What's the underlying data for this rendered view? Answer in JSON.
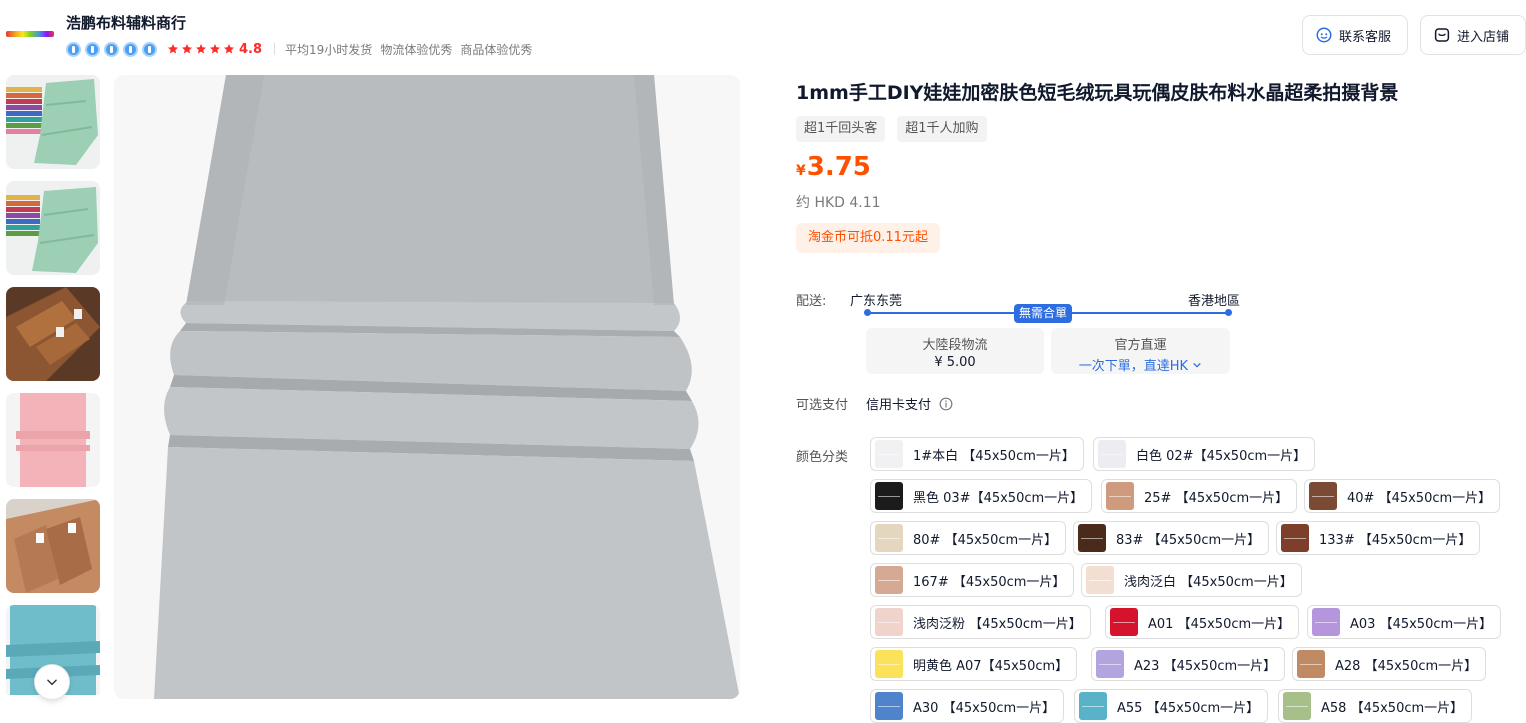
{
  "shop": {
    "name": "浩鹏布料辅料商行",
    "rating": "4.8",
    "meta": [
      "平均19小时发货",
      "物流体验优秀",
      "商品体验优秀"
    ],
    "service_label": "联系客服",
    "store_label": "进入店铺"
  },
  "product": {
    "title": "1mm手工DIY娃娃加密肤色短毛绒玩具玩偶皮肤布料水晶超柔拍摄背景",
    "tags": [
      "超1千回头客",
      "超1千人加购"
    ],
    "price_currency": "¥",
    "price": "3.75",
    "price_converted": "约 HKD 4.11",
    "coin_offer": "淘金币可抵0.11元起"
  },
  "shipping": {
    "label": "配送:",
    "from": "广东东莞",
    "to": "香港地區",
    "badge": "無需合單",
    "option_a_title": "大陸段物流",
    "option_a_price": "¥ 5.00",
    "option_b_title": "官方直運",
    "option_b_desc": "一次下單，直達HK"
  },
  "payment": {
    "label": "可选支付",
    "value": "信用卡支付"
  },
  "colors": {
    "label": "颜色分类",
    "items": [
      {
        "label": "1#本白 【45x50cm一片】",
        "swatch": "#f1f1f4"
      },
      {
        "label": "白色 02#【45x50cm一片】",
        "swatch": "#ececf2"
      },
      {
        "label": "黑色 03#【45x50cm一片】",
        "swatch": "#1b1b1b"
      },
      {
        "label": "25# 【45x50cm一片】",
        "swatch": "#cf9a7d"
      },
      {
        "label": "40# 【45x50cm一片】",
        "swatch": "#7a4a35"
      },
      {
        "label": "80# 【45x50cm一片】",
        "swatch": "#e5d6c0"
      },
      {
        "label": "83# 【45x50cm一片】",
        "swatch": "#4a2a1a"
      },
      {
        "label": "133# 【45x50cm一片】",
        "swatch": "#7d3f2c"
      },
      {
        "label": "167# 【45x50cm一片】",
        "swatch": "#d5a993"
      },
      {
        "label": "浅肉泛白 【45x50cm一片】",
        "swatch": "#f3dfd2"
      },
      {
        "label": "浅肉泛粉 【45x50cm一片】",
        "swatch": "#f0d3cb"
      },
      {
        "label": "A01 【45x50cm一片】",
        "swatch": "#d6132c"
      },
      {
        "label": "A03 【45x50cm一片】",
        "swatch": "#b596dc"
      },
      {
        "label": "明黄色 A07【45x50cm】",
        "swatch": "#fbe25a"
      },
      {
        "label": "A23 【45x50cm一片】",
        "swatch": "#b3a4e0"
      },
      {
        "label": "A28 【45x50cm一片】",
        "swatch": "#c08b63"
      },
      {
        "label": "A30 【45x50cm一片】",
        "swatch": "#4f83cc"
      },
      {
        "label": "A55 【45x50cm一片】",
        "swatch": "#58b2c8"
      },
      {
        "label": "A58 【45x50cm一片】",
        "swatch": "#a7c08a"
      }
    ]
  }
}
